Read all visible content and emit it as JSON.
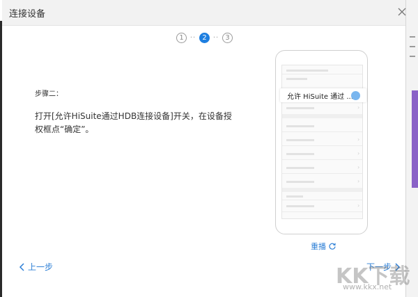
{
  "window": {
    "title": "连接设备"
  },
  "steps": [
    {
      "label": "1",
      "active": false
    },
    {
      "label": "2",
      "active": true
    },
    {
      "label": "3",
      "active": false
    }
  ],
  "step_dots": "··",
  "content": {
    "step_label": "步骤二：",
    "instruction": "打开[允许HiSuite通过HDB连接设备]开关，在设备授权框点“确定”。"
  },
  "phone": {
    "popup_text": "允许 HiSuite 通过 ..."
  },
  "replay": {
    "label": "重播"
  },
  "nav": {
    "prev_label": "上一步",
    "next_label": "下一步"
  },
  "watermark": {
    "logo_text": "KK下载",
    "url": "www.kkx.net"
  },
  "colors": {
    "accent": "#1e7fe0",
    "link": "#2d7fd6",
    "side_accent": "#8a62c7"
  }
}
